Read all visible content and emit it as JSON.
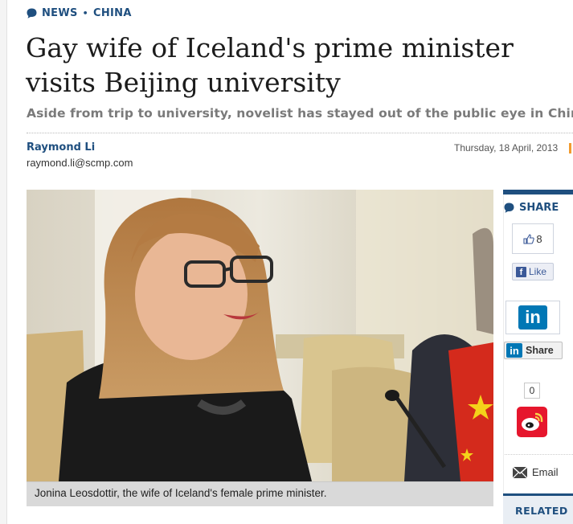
{
  "breadcrumb": {
    "section": "NEWS",
    "separator": "•",
    "subsection": "CHINA"
  },
  "article": {
    "headline": "Gay wife of Iceland's prime minister visits Beijing university",
    "subheadline": "Aside from trip to university, novelist has stayed out of the public eye in China",
    "author": "Raymond Li",
    "author_email": "raymond.li@scmp.com",
    "date": "Thursday, 18 April, 2013",
    "photo_caption": "Jonina Leosdottir, the wife of Iceland's female prime minister."
  },
  "share": {
    "heading": "SHARE",
    "facebook_count": "8",
    "facebook_like_label": "Like",
    "linkedin_label": "Share",
    "weibo_count": "0",
    "email_label": "Email"
  },
  "related": {
    "heading": "RELATED"
  },
  "colors": {
    "brand": "#1f4f7f",
    "accent": "#f29b2f",
    "facebook": "#3b5998",
    "linkedin": "#0077b5",
    "weibo": "#e6162d"
  }
}
